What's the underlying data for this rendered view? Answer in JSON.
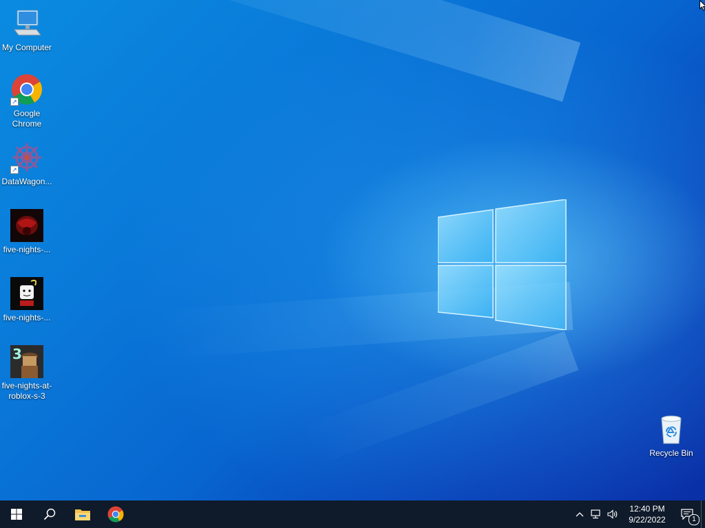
{
  "desktop": {
    "icons": [
      {
        "label": "My Computer",
        "icon": "computer-icon"
      },
      {
        "label": "Google Chrome",
        "icon": "chrome-icon"
      },
      {
        "label": "DataWagon...",
        "icon": "datawagon-icon"
      },
      {
        "label": "five-nights-...",
        "icon": "game-thumbnail-red"
      },
      {
        "label": "five-nights-...",
        "icon": "game-thumbnail-roblox"
      },
      {
        "label": "five-nights-at-roblox-s-3",
        "icon": "game-thumbnail-3"
      }
    ],
    "recycle_bin": {
      "label": "Recycle Bin",
      "icon": "recycle-bin-icon"
    }
  },
  "taskbar": {
    "pinned": [
      "start-icon",
      "search-icon",
      "file-explorer-icon",
      "chrome-icon"
    ],
    "clock": {
      "time": "12:40 PM",
      "date": "9/22/2022"
    },
    "notification_count": "1"
  },
  "colors": {
    "taskbar": "#0f1a2a",
    "wallpaper_primary": "#0a7ad9",
    "wallpaper_dark": "#0a2fa6"
  }
}
